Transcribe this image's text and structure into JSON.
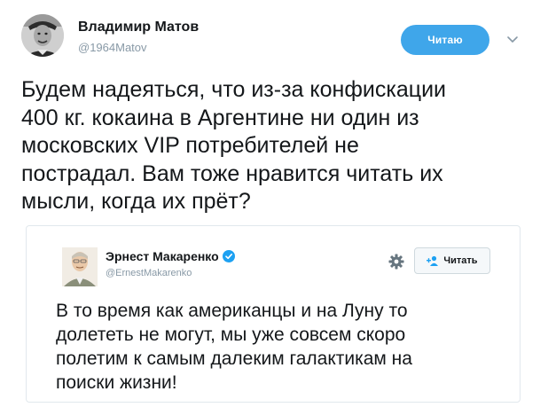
{
  "tweet": {
    "author_name": "Владимир Матов",
    "author_handle": "@1964Matov",
    "follow_label": "Читаю",
    "text": "Будем надеяться, что из-за конфискации\n400 кг. кокаина в Аргентине ни один из\nмосковских VIP потребителей не\nпострадал. Вам тоже нравится читать их\nмысли, когда их прёт?",
    "avatar_icon": "user-avatar-photo",
    "menu_icon": "chevron-down-icon"
  },
  "quoted_tweet": {
    "author_name": "Эрнест Макаренко",
    "author_handle": "@ErnestMakarenko",
    "follow_label": "Читать",
    "text": "В то время как американцы и на Луну то\nдолететь не могут, мы уже совсем скоро\nполетим к самым далеким галактикам на\nпоиски жизни!",
    "verified_icon": "verified-badge-icon",
    "settings_icon": "gear-icon",
    "follow_icon": "person-plus-icon"
  },
  "colors": {
    "accent": "#3fa6ea",
    "verified": "#1da1f2",
    "text": "#14171a",
    "secondary_text": "#8899a6",
    "border": "#e1e8ed"
  }
}
